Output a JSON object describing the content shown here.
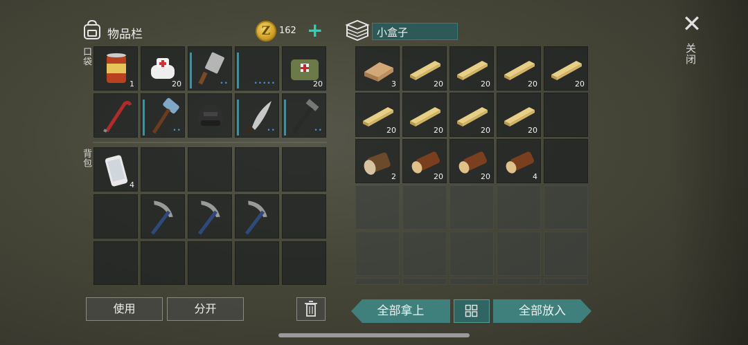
{
  "inventory": {
    "title": "物品栏",
    "coins": "162",
    "coin_symbol": "Z",
    "add_symbol": "+",
    "pocket_label": "口袋",
    "backpack_label": "背包",
    "pocket_items": [
      {
        "name": "canned-food",
        "qty": "1"
      },
      {
        "name": "bandage",
        "qty": "20"
      },
      {
        "name": "cleaver",
        "qty": "",
        "dots": "••"
      },
      {
        "name": "pistol",
        "qty": "",
        "dots": "•••••"
      },
      {
        "name": "medkit-bag",
        "qty": "20"
      },
      {
        "name": "crowbar",
        "qty": ""
      },
      {
        "name": "sledgehammer",
        "qty": "",
        "dots": "••"
      },
      {
        "name": "helmet",
        "qty": ""
      },
      {
        "name": "machete",
        "qty": "",
        "dots": "••"
      },
      {
        "name": "hammer",
        "qty": "",
        "dots": "••"
      }
    ],
    "backpack_items": [
      {
        "name": "smartphone",
        "qty": "4"
      },
      {
        "name": "",
        "qty": ""
      },
      {
        "name": "",
        "qty": ""
      },
      {
        "name": "",
        "qty": ""
      },
      {
        "name": "",
        "qty": ""
      },
      {
        "name": "",
        "qty": ""
      },
      {
        "name": "pickaxe",
        "qty": ""
      },
      {
        "name": "pickaxe",
        "qty": ""
      },
      {
        "name": "pickaxe",
        "qty": ""
      },
      {
        "name": "",
        "qty": ""
      }
    ],
    "use_label": "使用",
    "split_label": "分开"
  },
  "container": {
    "name": "小盒子",
    "items": [
      {
        "name": "wood-plank",
        "qty": "3"
      },
      {
        "name": "wood-board",
        "qty": "20"
      },
      {
        "name": "wood-board",
        "qty": "20"
      },
      {
        "name": "wood-board",
        "qty": "20"
      },
      {
        "name": "wood-board",
        "qty": "20"
      },
      {
        "name": "wood-board",
        "qty": "20"
      },
      {
        "name": "wood-board",
        "qty": "20"
      },
      {
        "name": "wood-board",
        "qty": "20"
      },
      {
        "name": "wood-board",
        "qty": "20"
      },
      {
        "name": "",
        "qty": ""
      },
      {
        "name": "log-pale",
        "qty": "2"
      },
      {
        "name": "log",
        "qty": "20"
      },
      {
        "name": "log",
        "qty": "20"
      },
      {
        "name": "log",
        "qty": "4"
      },
      {
        "name": "",
        "qty": ""
      }
    ],
    "take_all_label": "全部拿上",
    "put_all_label": "全部放入"
  },
  "close_label": "关闭",
  "colors": {
    "accent": "#3f807c",
    "plus": "#2fd1b8",
    "coin": "#e8c04a",
    "durability": "#4a8c98"
  }
}
